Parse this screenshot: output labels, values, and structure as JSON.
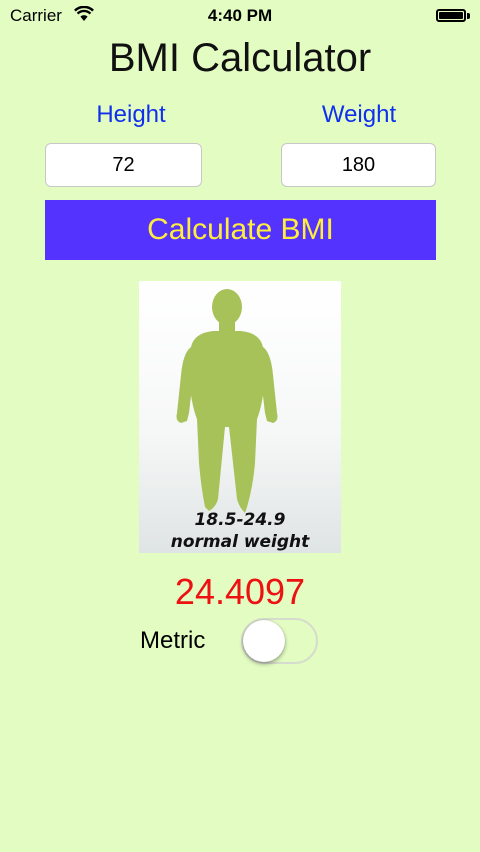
{
  "status_bar": {
    "carrier": "Carrier",
    "time": "4:40 PM",
    "wifi_icon": "wifi-icon",
    "battery_icon": "battery-icon",
    "battery_level": 1.0
  },
  "app": {
    "title": "BMI Calculator"
  },
  "form": {
    "height_label": "Height",
    "weight_label": "Weight",
    "height_value": "72",
    "weight_value": "180",
    "calculate_label": "Calculate BMI"
  },
  "bmi_image": {
    "range_text": "18.5-24.9",
    "category_text": "normal weight",
    "icon": "human-silhouette-icon",
    "figure_color": "#a8c25a"
  },
  "result": {
    "bmi_value": "24.4097"
  },
  "metric": {
    "label": "Metric",
    "enabled": false
  },
  "colors": {
    "background": "#e2fcc2",
    "label_blue": "#1030ee",
    "button_bg": "#5533ff",
    "button_text": "#ffee3c",
    "result_red": "#ee1111"
  }
}
